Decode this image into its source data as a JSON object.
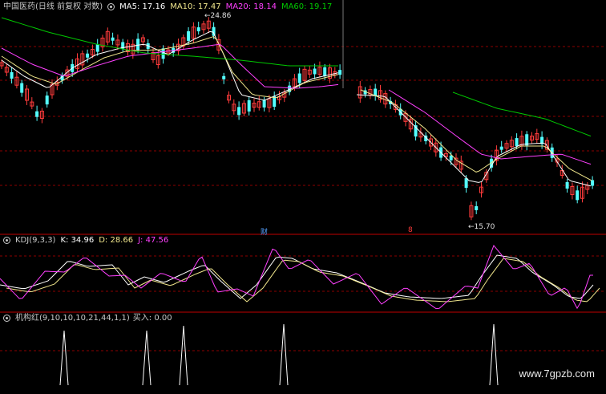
{
  "main_panel": {
    "stock_name": "中国医药",
    "period_info": "(日线 前复权 对数)",
    "ma5": "MA5: 17.16",
    "ma10": "MA10: 17.47",
    "ma20": "MA20: 18.14",
    "ma60": "MA60: 19.17",
    "high_marker": "24.86",
    "low_marker": "15.70",
    "fin_marker": "财",
    "ex_marker": "8"
  },
  "kdj_panel": {
    "name": "KDJ(9,3,3)",
    "k": "K: 34.96",
    "d": "D: 28.66",
    "j": "J: 47.56"
  },
  "signal_panel": {
    "name": "机构红(9,10,10,10,21,44,1,1)",
    "buy": "买入: 0.00"
  },
  "watermark": "www.7gpzb.com",
  "colors": {
    "up": "#ff3b3b",
    "down": "#54ffff",
    "ma5": "#ffffff",
    "ma10": "#f0e68c",
    "ma20": "#ff40ff",
    "ma60": "#00c800",
    "grid": "#8b0000",
    "k": "#ffffff",
    "d": "#f0e68c",
    "j": "#ff40ff",
    "label": "#c8c8c8"
  }
}
